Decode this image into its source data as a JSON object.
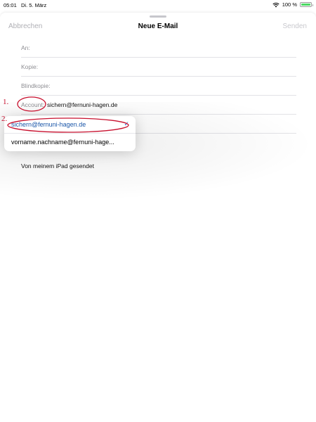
{
  "status_bar": {
    "time": "05:01",
    "date": "Di. 5. März",
    "battery_text": "100 %"
  },
  "nav": {
    "cancel": "Abbrechen",
    "title": "Neue E-Mail",
    "send": "Senden"
  },
  "fields": {
    "to_label": "An:",
    "cc_label": "Kopie:",
    "bcc_label": "Blindkopie:",
    "account_label": "Account:",
    "account_value": "sichern@fernuni-hagen.de"
  },
  "account_menu": {
    "options": [
      "sichern@fernuni-hagen.de",
      "vorname.nachname@fernuni-hage..."
    ],
    "selected": "sichern@fernuni-hagen.de"
  },
  "signature": "Von meinem iPad gesendet",
  "annotations": [
    "1.",
    "2."
  ],
  "colors": {
    "accent": "#2f6fd6",
    "annotation": "#c8102e",
    "battery": "#4cd964"
  }
}
